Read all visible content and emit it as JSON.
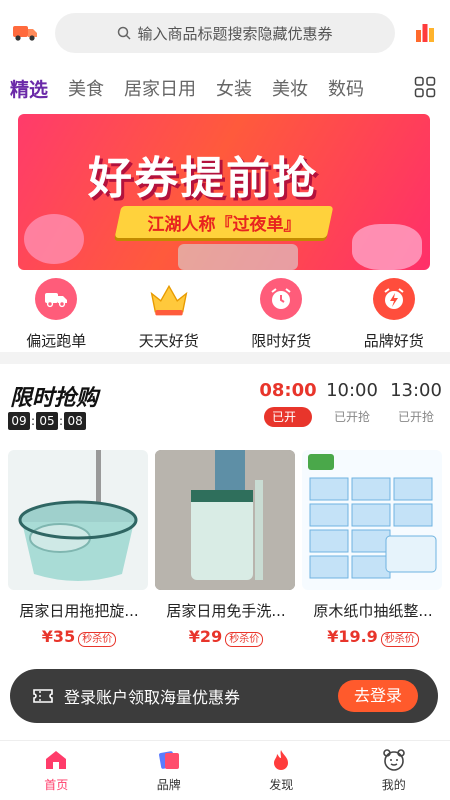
{
  "header": {
    "search_placeholder": "输入商品标题搜索隐藏优惠券"
  },
  "tabs": [
    "精选",
    "美食",
    "居家日用",
    "女装",
    "美妆",
    "数码"
  ],
  "banner": {
    "title": "好券提前抢",
    "subtitle": "江湖人称『过夜单』"
  },
  "categories": [
    {
      "label": "偏远跑单",
      "icon": "truck-icon"
    },
    {
      "label": "天天好货",
      "icon": "crown-icon"
    },
    {
      "label": "限时好货",
      "icon": "alarm-clock-icon"
    },
    {
      "label": "品牌好货",
      "icon": "lightning-clock-icon"
    }
  ],
  "flash_sale": {
    "title": "限时抢购",
    "countdown": [
      "09",
      "05",
      "08"
    ],
    "slots": [
      {
        "time": "08:00",
        "status": "已开抢"
      },
      {
        "time": "10:00",
        "status": "已开抢"
      },
      {
        "time": "13:00",
        "status": "已开抢"
      }
    ],
    "products": [
      {
        "name": "居家日用拖把旋...",
        "price": "¥35",
        "tag": "秒杀价"
      },
      {
        "name": "居家日用免手洗...",
        "price": "¥29",
        "tag": "秒杀价"
      },
      {
        "name": "原木纸巾抽纸整...",
        "price": "¥19.9",
        "tag": "秒杀价"
      }
    ]
  },
  "login_bar": {
    "text": "登录账户领取海量优惠券",
    "button": "去登录"
  },
  "bottom_nav": [
    {
      "label": "首页",
      "icon": "home-icon"
    },
    {
      "label": "品牌",
      "icon": "brand-cards-icon"
    },
    {
      "label": "发现",
      "icon": "flame-icon"
    },
    {
      "label": "我的",
      "icon": "bear-face-icon"
    }
  ],
  "colors": {
    "accent_tab": "#6a29a8",
    "price_red": "#e8352b",
    "nav_active": "#ff3c6a",
    "login_button": "#ff5a2c"
  }
}
